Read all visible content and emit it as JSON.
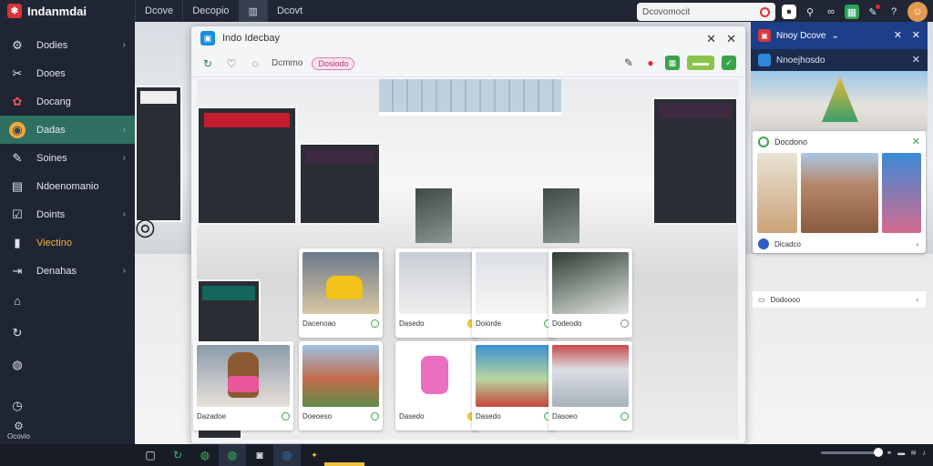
{
  "app": {
    "name": "Indanmdai"
  },
  "topnav": [
    "Dcove",
    "Decopio",
    "",
    "Dcovt"
  ],
  "search": {
    "placeholder": "Dcovomocit"
  },
  "sidebar": {
    "items": [
      {
        "label": "Dodies",
        "icon": "settings-icon",
        "chevron": true
      },
      {
        "label": "Dooes",
        "icon": "tools-icon",
        "chevron": false
      },
      {
        "label": "Docang",
        "icon": "apps-icon",
        "chevron": false
      },
      {
        "label": "Dadas",
        "icon": "orange-badge-icon",
        "chevron": true,
        "active": true
      },
      {
        "label": "Soines",
        "icon": "pen-icon",
        "chevron": true
      },
      {
        "label": "Ndoenomanio",
        "icon": "monitor-icon",
        "chevron": false
      },
      {
        "label": "Doints",
        "icon": "checkbox-icon",
        "chevron": true
      },
      {
        "label": "Viectino",
        "icon": "document-icon",
        "chevron": false,
        "highlight": true
      },
      {
        "label": "Denahas",
        "icon": "arrow-right-box-icon",
        "chevron": true
      }
    ],
    "footer": "Ocovio"
  },
  "main_window": {
    "title": "Indo Idecbay",
    "toolbar": {
      "plain_label": "Dcmmo",
      "pill_label": "Dosiodo"
    },
    "cards": [
      {
        "caption": "Dacenoao"
      },
      {
        "caption": "Dasedo"
      },
      {
        "caption": "Doiorde"
      },
      {
        "caption": "Dodeodo"
      },
      {
        "caption": "Dazadoe"
      },
      {
        "caption": "Doeoeso"
      },
      {
        "caption": "Dasedo"
      },
      {
        "caption": "Dasedo"
      },
      {
        "caption": "Dasoeo"
      }
    ]
  },
  "side_panel": {
    "header": "Nnoy Dcove",
    "subheader": "Nnoejhosdo",
    "card_title": "Docdono",
    "card_footer": "Dicadco",
    "row_label": "Dodoooo"
  }
}
